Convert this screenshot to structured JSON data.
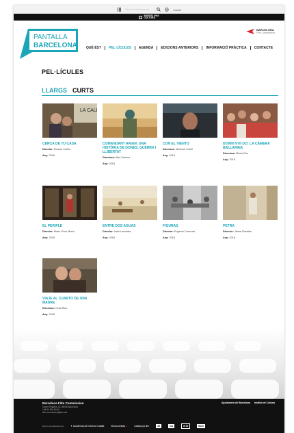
{
  "topbar": {
    "search_placeholder": "Cerca a barcelona.cat",
    "language": "Català"
  },
  "header": {
    "logo_line1": "PANTALLA",
    "logo_line2": "BARCELONA",
    "site_logo": "BARCELONA\nCULTURA",
    "bfc_line1": "BARCELONA",
    "bfc_line2": "Film Commission"
  },
  "nav": [
    {
      "label": "QUÈ ÉS?"
    },
    {
      "label": "PEL·LÍCULES"
    },
    {
      "label": "AGENDA"
    },
    {
      "label": "EDICIONS ANTERIORS"
    },
    {
      "label": "INFORMACIÓ PRÀCTICA"
    },
    {
      "label": "CONTACTE"
    }
  ],
  "page_title": "PEL·LÍCULES",
  "tabs": {
    "active": "LLARGS",
    "inactive": "CURTS"
  },
  "films": [
    {
      "title": "CERCA DE TU CASA",
      "dir_label": "Director:",
      "director": "Eduard Cortés",
      "year_label": "Any:",
      "year": "2016"
    },
    {
      "title": "COMANDANT ARIAN: UNA HISTÒRIA DE DONES, GUERRA I LLIBERTAT",
      "dir_label": "Directora:",
      "director": "Alba Sotorra",
      "year_label": "Any:",
      "year": "2018"
    },
    {
      "title": "CON EL VIENTO",
      "dir_label": "Directora:",
      "director": "Meritxell Colell",
      "year_label": "Any:",
      "year": "2018"
    },
    {
      "title": "DOWN N'HI DO: LA CÀMERA BALLARINA",
      "dir_label": "Directora:",
      "director": "Mireia Ros",
      "year_label": "Any:",
      "year": "2018"
    },
    {
      "title": "EL PERIPLE",
      "dir_label": "Director:",
      "director": "Mario Pons Muria",
      "year_label": "Any:",
      "year": "2018"
    },
    {
      "title": "ENTRE DOS AGUAS",
      "dir_label": "Director:",
      "director": "Isaki Lacuesta",
      "year_label": "Any:",
      "year": "2018"
    },
    {
      "title": "FIGURAS",
      "dir_label": "Director:",
      "director": "Eugenio Canevari",
      "year_label": "Any:",
      "year": "2018"
    },
    {
      "title": "PETRA",
      "dir_label": "Director:",
      "director": "Jaime Rosales",
      "year_label": "Any:",
      "year": "2018"
    },
    {
      "title": "VIAJE AL CUARTO DE UNA MADRE",
      "dir_label": "Directora:",
      "director": "Celia Rico",
      "year_label": "Any:",
      "year": "2018"
    }
  ],
  "footer": {
    "name": "Barcelona Film Commission",
    "address1": "Carrer Pujades, 61 08005 Barcelona",
    "address2": "+34 93 454 80 60",
    "address3": "film.commission@bcn.cat",
    "right1": "Ajuntament de Barcelona",
    "right2": "Institut de Cultura",
    "sponsors_label": "amb la col·laboració de",
    "logo_academia": "Acadèmia del Cinema Català",
    "logo_eleconomista": "eleconomista",
    "logo_catalunya": "Catalunya film",
    "logo_26": "26",
    "logo_da": "DA",
    "logo_bwa": "B·W",
    "logo_bcn": "BCN"
  }
}
